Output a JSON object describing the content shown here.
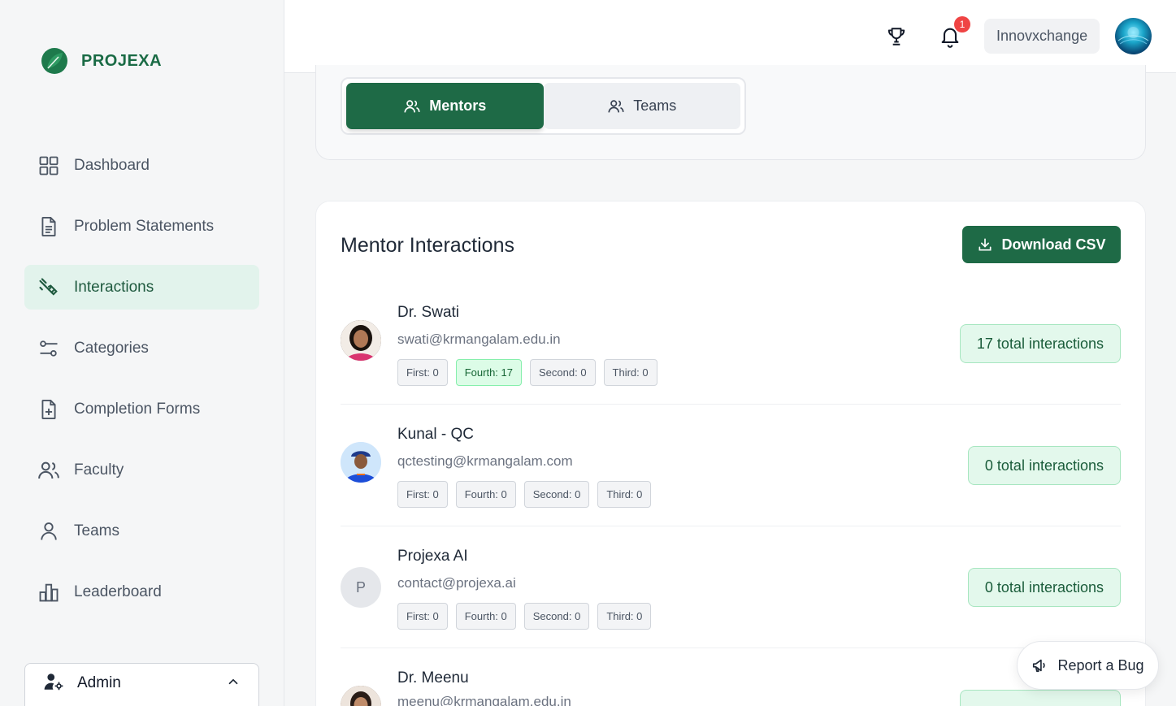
{
  "brand": {
    "name": "PROJEXA",
    "color": "#1a6b45"
  },
  "sidebar": {
    "items": [
      {
        "label": "Dashboard",
        "icon": "grid-icon",
        "active": false
      },
      {
        "label": "Problem Statements",
        "icon": "document-icon",
        "active": false
      },
      {
        "label": "Interactions",
        "icon": "handshake-icon",
        "active": true
      },
      {
        "label": "Categories",
        "icon": "sliders-icon",
        "active": false
      },
      {
        "label": "Completion Forms",
        "icon": "file-plus-icon",
        "active": false
      },
      {
        "label": "Faculty",
        "icon": "users-icon",
        "active": false
      },
      {
        "label": "Teams",
        "icon": "user-icon",
        "active": false
      },
      {
        "label": "Leaderboard",
        "icon": "bar-chart-icon",
        "active": false
      }
    ],
    "admin": {
      "label": "Admin"
    }
  },
  "header": {
    "notifications_count": "1",
    "org": "Innovxchange"
  },
  "tabs": [
    {
      "label": "Mentors",
      "active": true
    },
    {
      "label": "Teams",
      "active": false
    }
  ],
  "main": {
    "title": "Mentor Interactions",
    "download_label": "Download CSV",
    "mentors": [
      {
        "name": "Dr. Swati",
        "email": "swati@krmangalam.edu.in",
        "chips": [
          "First: 0",
          "Fourth: 17",
          "Second: 0",
          "Third: 0"
        ],
        "total": "17 total interactions"
      },
      {
        "name": "Kunal - QC",
        "email": "qctesting@krmangalam.com",
        "chips": [
          "First: 0",
          "Fourth: 0",
          "Second: 0",
          "Third: 0"
        ],
        "total": "0 total interactions"
      },
      {
        "name": "Projexa AI",
        "initial": "P",
        "email": "contact@projexa.ai",
        "chips": [
          "First: 0",
          "Fourth: 0",
          "Second: 0",
          "Third: 0"
        ],
        "total": "0 total interactions"
      },
      {
        "name": "Dr. Meenu",
        "email": "meenu@krmangalam.edu.in"
      }
    ]
  },
  "report_bug": {
    "label": "Report a Bug"
  }
}
